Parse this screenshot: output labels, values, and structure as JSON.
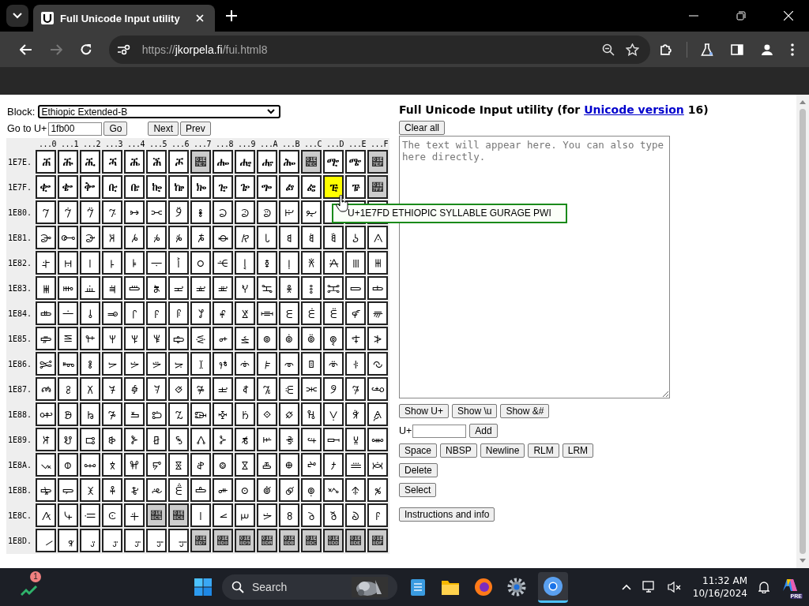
{
  "browser": {
    "tab_title": "Full Unicode Input utility",
    "url_scheme": "https://",
    "url_host": "jkorpela.fi",
    "url_path": "/fui.html8"
  },
  "block": {
    "label": "Block:",
    "value": "Ethiopic Extended-B"
  },
  "goto": {
    "label": "Go to U+",
    "value": "1fb00",
    "go": "Go",
    "next": "Next",
    "prev": "Prev"
  },
  "grid": {
    "columns": [
      "...0",
      "...1",
      "...2",
      "...3",
      "...4",
      "...5",
      "...6",
      "...7",
      "...8",
      "...9",
      "...A",
      "...B",
      "...C",
      "...D",
      "...E",
      "...F"
    ],
    "rows": [
      {
        "label": "1E7E.",
        "cells": [
          {
            "char": "𞟠",
            "kind": "assigned"
          },
          {
            "char": "𞟡",
            "kind": "assigned"
          },
          {
            "char": "𞟢",
            "kind": "assigned"
          },
          {
            "char": "𞟣",
            "kind": "assigned"
          },
          {
            "char": "𞟤",
            "kind": "assigned"
          },
          {
            "char": "𞟥",
            "kind": "assigned"
          },
          {
            "char": "𞟦",
            "kind": "assigned"
          },
          {
            "char": "𞟧",
            "kind": "unassigned"
          },
          {
            "char": "𞟨",
            "kind": "assigned"
          },
          {
            "char": "𞟩",
            "kind": "assigned"
          },
          {
            "char": "𞟪",
            "kind": "assigned"
          },
          {
            "char": "𞟫",
            "kind": "assigned"
          },
          {
            "char": "𞟬",
            "kind": "unassigned"
          },
          {
            "char": "𞟭",
            "kind": "assigned"
          },
          {
            "char": "𞟮",
            "kind": "assigned"
          },
          {
            "char": "𞟯",
            "kind": "unassigned"
          }
        ]
      },
      {
        "label": "1E7F.",
        "cells": [
          {
            "char": "𞟰",
            "kind": "assigned"
          },
          {
            "char": "𞟱",
            "kind": "assigned"
          },
          {
            "char": "𞟲",
            "kind": "assigned"
          },
          {
            "char": "𞟳",
            "kind": "assigned"
          },
          {
            "char": "𞟴",
            "kind": "assigned"
          },
          {
            "char": "𞟵",
            "kind": "assigned"
          },
          {
            "char": "𞟶",
            "kind": "assigned"
          },
          {
            "char": "𞟷",
            "kind": "assigned"
          },
          {
            "char": "𞟸",
            "kind": "assigned"
          },
          {
            "char": "𞟹",
            "kind": "assigned"
          },
          {
            "char": "𞟺",
            "kind": "assigned"
          },
          {
            "char": "𞟻",
            "kind": "assigned"
          },
          {
            "char": "𞟼",
            "kind": "assigned"
          },
          {
            "char": "𞟽",
            "kind": "highlighted"
          },
          {
            "char": "𞟾",
            "kind": "assigned"
          },
          {
            "char": "𞟿",
            "kind": "unassigned"
          }
        ]
      },
      {
        "label": "1E80.",
        "cells": [
          {
            "char": "𞠀",
            "kind": "assigned"
          },
          {
            "char": "𞠁",
            "kind": "assigned"
          },
          {
            "char": "𞠂",
            "kind": "assigned"
          },
          {
            "char": "𞠃",
            "kind": "assigned"
          },
          {
            "char": "𞠄",
            "kind": "assigned"
          },
          {
            "char": "𞠅",
            "kind": "assigned"
          },
          {
            "char": "𞠆",
            "kind": "assigned"
          },
          {
            "char": "𞠇",
            "kind": "assigned"
          },
          {
            "char": "𞠈",
            "kind": "assigned"
          },
          {
            "char": "𞠉",
            "kind": "assigned"
          },
          {
            "char": "𞠊",
            "kind": "assigned"
          },
          {
            "char": "𞠋",
            "kind": "assigned"
          },
          {
            "char": "𞠌",
            "kind": "assigned"
          },
          {
            "kind": "assigned"
          },
          {
            "kind": "assigned"
          },
          {
            "kind": "assigned"
          }
        ]
      },
      {
        "label": "1E81.",
        "cells": [
          {
            "char": "𞠐",
            "kind": "assigned"
          },
          {
            "char": "𞠑",
            "kind": "assigned"
          },
          {
            "char": "𞠒",
            "kind": "assigned"
          },
          {
            "char": "𞠓",
            "kind": "assigned"
          },
          {
            "char": "𞠔",
            "kind": "assigned"
          },
          {
            "char": "𞠕",
            "kind": "assigned"
          },
          {
            "char": "𞠖",
            "kind": "assigned"
          },
          {
            "char": "𞠗",
            "kind": "assigned"
          },
          {
            "char": "𞠘",
            "kind": "assigned"
          },
          {
            "char": "𞠙",
            "kind": "assigned"
          },
          {
            "char": "𞠚",
            "kind": "assigned"
          },
          {
            "char": "𞠛",
            "kind": "assigned"
          },
          {
            "char": "𞠜",
            "kind": "assigned"
          },
          {
            "char": "𞠝",
            "kind": "assigned"
          },
          {
            "char": "𞠞",
            "kind": "assigned"
          },
          {
            "char": "𞠟",
            "kind": "assigned"
          }
        ]
      },
      {
        "label": "1E82.",
        "cells": [
          {
            "char": "𞠠",
            "kind": "assigned"
          },
          {
            "char": "𞠡",
            "kind": "assigned"
          },
          {
            "char": "𞠢",
            "kind": "assigned"
          },
          {
            "char": "𞠣",
            "kind": "assigned"
          },
          {
            "char": "𞠤",
            "kind": "assigned"
          },
          {
            "char": "𞠥",
            "kind": "assigned"
          },
          {
            "char": "𞠦",
            "kind": "assigned"
          },
          {
            "char": "𞠧",
            "kind": "assigned"
          },
          {
            "char": "𞠨",
            "kind": "assigned"
          },
          {
            "char": "𞠩",
            "kind": "assigned"
          },
          {
            "char": "𞠪",
            "kind": "assigned"
          },
          {
            "char": "𞠫",
            "kind": "assigned"
          },
          {
            "char": "𞠬",
            "kind": "assigned"
          },
          {
            "char": "𞠭",
            "kind": "assigned"
          },
          {
            "char": "𞠮",
            "kind": "assigned"
          },
          {
            "char": "𞠯",
            "kind": "assigned"
          }
        ]
      },
      {
        "label": "1E83.",
        "cells": [
          {
            "char": "𞠰",
            "kind": "assigned"
          },
          {
            "char": "𞠱",
            "kind": "assigned"
          },
          {
            "char": "𞠲",
            "kind": "assigned"
          },
          {
            "char": "𞠳",
            "kind": "assigned"
          },
          {
            "char": "𞠴",
            "kind": "assigned"
          },
          {
            "char": "𞠵",
            "kind": "assigned"
          },
          {
            "char": "𞠶",
            "kind": "assigned"
          },
          {
            "char": "𞠷",
            "kind": "assigned"
          },
          {
            "char": "𞠸",
            "kind": "assigned"
          },
          {
            "char": "𞠹",
            "kind": "assigned"
          },
          {
            "char": "𞠺",
            "kind": "assigned"
          },
          {
            "char": "𞠻",
            "kind": "assigned"
          },
          {
            "char": "𞠼",
            "kind": "assigned"
          },
          {
            "char": "𞠽",
            "kind": "assigned"
          },
          {
            "char": "𞠾",
            "kind": "assigned"
          },
          {
            "char": "𞠿",
            "kind": "assigned"
          }
        ]
      },
      {
        "label": "1E84.",
        "cells": [
          {
            "char": "𞡀",
            "kind": "assigned"
          },
          {
            "char": "𞡁",
            "kind": "assigned"
          },
          {
            "char": "𞡂",
            "kind": "assigned"
          },
          {
            "char": "𞡃",
            "kind": "assigned"
          },
          {
            "char": "𞡄",
            "kind": "assigned"
          },
          {
            "char": "𞡅",
            "kind": "assigned"
          },
          {
            "char": "𞡆",
            "kind": "assigned"
          },
          {
            "char": "𞡇",
            "kind": "assigned"
          },
          {
            "char": "𞡈",
            "kind": "assigned"
          },
          {
            "char": "𞡉",
            "kind": "assigned"
          },
          {
            "char": "𞡊",
            "kind": "assigned"
          },
          {
            "char": "𞡋",
            "kind": "assigned"
          },
          {
            "char": "𞡌",
            "kind": "assigned"
          },
          {
            "char": "𞡍",
            "kind": "assigned"
          },
          {
            "char": "𞡎",
            "kind": "assigned"
          },
          {
            "char": "𞡏",
            "kind": "assigned"
          }
        ]
      },
      {
        "label": "1E85.",
        "cells": [
          {
            "char": "𞡐",
            "kind": "assigned"
          },
          {
            "char": "𞡑",
            "kind": "assigned"
          },
          {
            "char": "𞡒",
            "kind": "assigned"
          },
          {
            "char": "𞡓",
            "kind": "assigned"
          },
          {
            "char": "𞡔",
            "kind": "assigned"
          },
          {
            "char": "𞡕",
            "kind": "assigned"
          },
          {
            "char": "𞡖",
            "kind": "assigned"
          },
          {
            "char": "𞡗",
            "kind": "assigned"
          },
          {
            "char": "𞡘",
            "kind": "assigned"
          },
          {
            "char": "𞡙",
            "kind": "assigned"
          },
          {
            "char": "𞡚",
            "kind": "assigned"
          },
          {
            "char": "𞡛",
            "kind": "assigned"
          },
          {
            "char": "𞡜",
            "kind": "assigned"
          },
          {
            "char": "𞡝",
            "kind": "assigned"
          },
          {
            "char": "𞡞",
            "kind": "assigned"
          },
          {
            "char": "𞡟",
            "kind": "assigned"
          }
        ]
      },
      {
        "label": "1E86.",
        "cells": [
          {
            "char": "𞡠",
            "kind": "assigned"
          },
          {
            "char": "𞡡",
            "kind": "assigned"
          },
          {
            "char": "𞡢",
            "kind": "assigned"
          },
          {
            "char": "𞡣",
            "kind": "assigned"
          },
          {
            "char": "𞡤",
            "kind": "assigned"
          },
          {
            "char": "𞡥",
            "kind": "assigned"
          },
          {
            "char": "𞡦",
            "kind": "assigned"
          },
          {
            "char": "𞡧",
            "kind": "assigned"
          },
          {
            "char": "𞡨",
            "kind": "assigned"
          },
          {
            "char": "𞡩",
            "kind": "assigned"
          },
          {
            "char": "𞡪",
            "kind": "assigned"
          },
          {
            "char": "𞡫",
            "kind": "assigned"
          },
          {
            "char": "𞡬",
            "kind": "assigned"
          },
          {
            "char": "𞡭",
            "kind": "assigned"
          },
          {
            "char": "𞡮",
            "kind": "assigned"
          },
          {
            "char": "𞡯",
            "kind": "assigned"
          }
        ]
      },
      {
        "label": "1E87.",
        "cells": [
          {
            "char": "𞡰",
            "kind": "assigned"
          },
          {
            "char": "𞡱",
            "kind": "assigned"
          },
          {
            "char": "𞡲",
            "kind": "assigned"
          },
          {
            "char": "𞡳",
            "kind": "assigned"
          },
          {
            "char": "𞡴",
            "kind": "assigned"
          },
          {
            "char": "𞡵",
            "kind": "assigned"
          },
          {
            "char": "𞡶",
            "kind": "assigned"
          },
          {
            "char": "𞡷",
            "kind": "assigned"
          },
          {
            "char": "𞡸",
            "kind": "assigned"
          },
          {
            "char": "𞡹",
            "kind": "assigned"
          },
          {
            "char": "𞡺",
            "kind": "assigned"
          },
          {
            "char": "𞡻",
            "kind": "assigned"
          },
          {
            "char": "𞡼",
            "kind": "assigned"
          },
          {
            "char": "𞡽",
            "kind": "assigned"
          },
          {
            "char": "𞡾",
            "kind": "assigned"
          },
          {
            "char": "𞡿",
            "kind": "assigned"
          }
        ]
      },
      {
        "label": "1E88.",
        "cells": [
          {
            "char": "𞢀",
            "kind": "assigned"
          },
          {
            "char": "𞢁",
            "kind": "assigned"
          },
          {
            "char": "𞢂",
            "kind": "assigned"
          },
          {
            "char": "𞢃",
            "kind": "assigned"
          },
          {
            "char": "𞢄",
            "kind": "assigned"
          },
          {
            "char": "𞢅",
            "kind": "assigned"
          },
          {
            "char": "𞢆",
            "kind": "assigned"
          },
          {
            "char": "𞢇",
            "kind": "assigned"
          },
          {
            "char": "𞢈",
            "kind": "assigned"
          },
          {
            "char": "𞢉",
            "kind": "assigned"
          },
          {
            "char": "𞢊",
            "kind": "assigned"
          },
          {
            "char": "𞢋",
            "kind": "assigned"
          },
          {
            "char": "𞢌",
            "kind": "assigned"
          },
          {
            "char": "𞢍",
            "kind": "assigned"
          },
          {
            "char": "𞢎",
            "kind": "assigned"
          },
          {
            "char": "𞢏",
            "kind": "assigned"
          }
        ]
      },
      {
        "label": "1E89.",
        "cells": [
          {
            "char": "𞢐",
            "kind": "assigned"
          },
          {
            "char": "𞢑",
            "kind": "assigned"
          },
          {
            "char": "𞢒",
            "kind": "assigned"
          },
          {
            "char": "𞢓",
            "kind": "assigned"
          },
          {
            "char": "𞢔",
            "kind": "assigned"
          },
          {
            "char": "𞢕",
            "kind": "assigned"
          },
          {
            "char": "𞢖",
            "kind": "assigned"
          },
          {
            "char": "𞢗",
            "kind": "assigned"
          },
          {
            "char": "𞢘",
            "kind": "assigned"
          },
          {
            "char": "𞢙",
            "kind": "assigned"
          },
          {
            "char": "𞢚",
            "kind": "assigned"
          },
          {
            "char": "𞢛",
            "kind": "assigned"
          },
          {
            "char": "𞢜",
            "kind": "assigned"
          },
          {
            "char": "𞢝",
            "kind": "assigned"
          },
          {
            "char": "𞢞",
            "kind": "assigned"
          },
          {
            "char": "𞢟",
            "kind": "assigned"
          }
        ]
      },
      {
        "label": "1E8A.",
        "cells": [
          {
            "char": "𞢠",
            "kind": "assigned"
          },
          {
            "char": "𞢡",
            "kind": "assigned"
          },
          {
            "char": "𞢢",
            "kind": "assigned"
          },
          {
            "char": "𞢣",
            "kind": "assigned"
          },
          {
            "char": "𞢤",
            "kind": "assigned"
          },
          {
            "char": "𞢥",
            "kind": "assigned"
          },
          {
            "char": "𞢦",
            "kind": "assigned"
          },
          {
            "char": "𞢧",
            "kind": "assigned"
          },
          {
            "char": "𞢨",
            "kind": "assigned"
          },
          {
            "char": "𞢩",
            "kind": "assigned"
          },
          {
            "char": "𞢪",
            "kind": "assigned"
          },
          {
            "char": "𞢫",
            "kind": "assigned"
          },
          {
            "char": "𞢬",
            "kind": "assigned"
          },
          {
            "char": "𞢭",
            "kind": "assigned"
          },
          {
            "char": "𞢮",
            "kind": "assigned"
          },
          {
            "char": "𞢯",
            "kind": "assigned"
          }
        ]
      },
      {
        "label": "1E8B.",
        "cells": [
          {
            "char": "𞢰",
            "kind": "assigned"
          },
          {
            "char": "𞢱",
            "kind": "assigned"
          },
          {
            "char": "𞢲",
            "kind": "assigned"
          },
          {
            "char": "𞢳",
            "kind": "assigned"
          },
          {
            "char": "𞢴",
            "kind": "assigned"
          },
          {
            "char": "𞢵",
            "kind": "assigned"
          },
          {
            "char": "𞢶",
            "kind": "assigned"
          },
          {
            "char": "𞢷",
            "kind": "assigned"
          },
          {
            "char": "𞢸",
            "kind": "assigned"
          },
          {
            "char": "𞢹",
            "kind": "assigned"
          },
          {
            "char": "𞢺",
            "kind": "assigned"
          },
          {
            "char": "𞢻",
            "kind": "assigned"
          },
          {
            "char": "𞢼",
            "kind": "assigned"
          },
          {
            "char": "𞢽",
            "kind": "assigned"
          },
          {
            "char": "𞢾",
            "kind": "assigned"
          },
          {
            "char": "𞢿",
            "kind": "assigned"
          }
        ]
      },
      {
        "label": "1E8C.",
        "cells": [
          {
            "char": "𞣀",
            "kind": "assigned"
          },
          {
            "char": "𞣁",
            "kind": "assigned"
          },
          {
            "char": "𞣂",
            "kind": "assigned"
          },
          {
            "char": "𞣃",
            "kind": "assigned"
          },
          {
            "char": "𞣄",
            "kind": "assigned"
          },
          {
            "char": "𞣅",
            "kind": "unassigned"
          },
          {
            "char": "𞣆",
            "kind": "unassigned"
          },
          {
            "char": "𞣇",
            "kind": "assigned"
          },
          {
            "char": "𞣈",
            "kind": "assigned"
          },
          {
            "char": "𞣉",
            "kind": "assigned"
          },
          {
            "char": "𞣊",
            "kind": "assigned"
          },
          {
            "char": "𞣋",
            "kind": "assigned"
          },
          {
            "char": "𞣌",
            "kind": "assigned"
          },
          {
            "char": "𞣍",
            "kind": "assigned"
          },
          {
            "char": "𞣎",
            "kind": "assigned"
          },
          {
            "char": "𞣏",
            "kind": "assigned"
          }
        ]
      },
      {
        "label": "1E8D.",
        "cells": [
          {
            "char": "𞣐",
            "kind": "assigned"
          },
          {
            "char": "𞣑",
            "kind": "assigned"
          },
          {
            "char": "𞣒",
            "kind": "assigned"
          },
          {
            "char": "𞣓",
            "kind": "assigned"
          },
          {
            "char": "𞣔",
            "kind": "assigned"
          },
          {
            "char": "𞣕",
            "kind": "assigned"
          },
          {
            "char": "𞣖",
            "kind": "assigned"
          },
          {
            "char": "𞣗",
            "kind": "unassigned"
          },
          {
            "char": "𞣘",
            "kind": "unassigned"
          },
          {
            "char": "𞣙",
            "kind": "unassigned"
          },
          {
            "char": "𞣚",
            "kind": "unassigned"
          },
          {
            "char": "𞣛",
            "kind": "unassigned"
          },
          {
            "char": "𞣜",
            "kind": "unassigned"
          },
          {
            "char": "𞣝",
            "kind": "unassigned"
          },
          {
            "char": "𞣞",
            "kind": "unassigned"
          },
          {
            "char": "𞣟",
            "kind": "unassigned"
          }
        ]
      }
    ]
  },
  "tooltip": "U+1E7FD ETHIOPIC SYLLABLE GURAGE PWI",
  "heading": {
    "before": "Full Unicode Input utility (for ",
    "link": "Unicode version",
    "after": " 16)"
  },
  "clear_button": "Clear all",
  "text_area": {
    "placeholder": "The text will appear here. You can also type here directly."
  },
  "show_buttons": [
    "Show U+",
    "Show \\u",
    "Show &#"
  ],
  "add": {
    "label": "U+",
    "button": "Add"
  },
  "insert_buttons": [
    "Space",
    "NBSP",
    "Newline",
    "RLM",
    "LRM"
  ],
  "delete_button": "Delete",
  "select_button": "Select",
  "info_button": "Instructions and info",
  "taskbar": {
    "notification_count": "1",
    "search_placeholder": "Search",
    "time": "11:32 AM",
    "date": "10/16/2024",
    "copilot_badge": "PRE"
  }
}
